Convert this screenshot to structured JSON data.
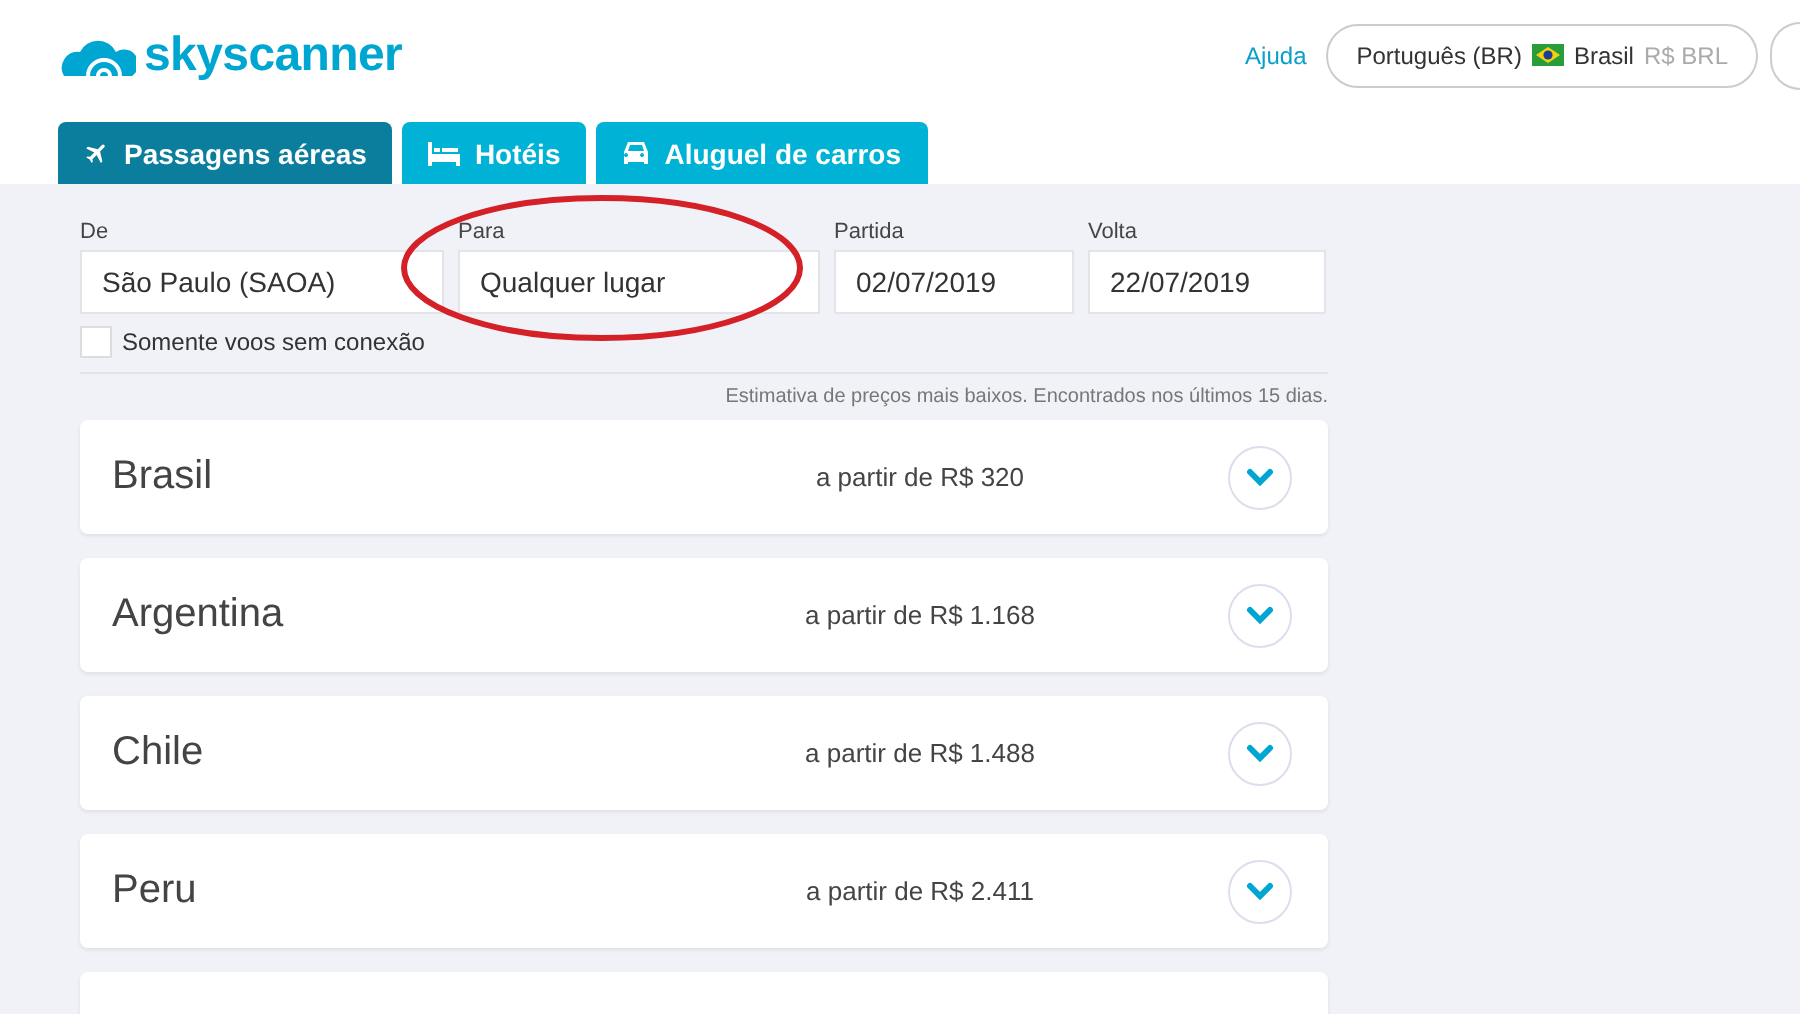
{
  "header": {
    "logo": "skyscanner",
    "help_link": "Ajuda",
    "locale": {
      "language": "Português (BR)",
      "country": "Brasil",
      "currency": "R$ BRL"
    }
  },
  "tabs": [
    {
      "label": "Passagens aéreas",
      "kind": "plane",
      "selected": true
    },
    {
      "label": "Hotéis",
      "kind": "bed",
      "selected": false
    },
    {
      "label": "Aluguel de carros",
      "kind": "car",
      "selected": false
    }
  ],
  "search": {
    "fields": [
      {
        "label": "De",
        "value": "São Paulo (SAOA)",
        "highlighted": false
      },
      {
        "label": "Para",
        "value": "Qualquer lugar",
        "highlighted": true
      },
      {
        "label": "Partida",
        "value": "02/07/2019",
        "highlighted": false
      },
      {
        "label": "Volta",
        "value": "22/07/2019",
        "highlighted": false
      }
    ],
    "direct_only": {
      "label": "Somente voos sem conexão",
      "checked": false
    }
  },
  "note": "Estimativa de preços mais baixos. Encontrados nos últimos 15 dias.",
  "results": [
    {
      "country": "Brasil",
      "price": "a partir de R$ 320",
      "expanded": false
    },
    {
      "country": "Argentina",
      "price": "a partir de R$ 1.168",
      "expanded": false
    },
    {
      "country": "Chile",
      "price": "a partir de R$ 1.488",
      "expanded": false
    },
    {
      "country": "Peru",
      "price": "a partir de R$ 2.411",
      "expanded": false
    }
  ]
}
